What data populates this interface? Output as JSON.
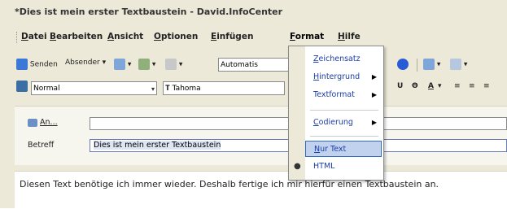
{
  "window": {
    "title": "*Dies ist mein erster Textbaustein - David.InfoCenter"
  },
  "menubar": {
    "items": [
      {
        "label": "Datei"
      },
      {
        "label": "Bearbeiten"
      },
      {
        "label": "Ansicht"
      },
      {
        "label": "Optionen"
      },
      {
        "label": "Einfügen"
      },
      {
        "label": "Format"
      },
      {
        "label": "Hilfe"
      }
    ]
  },
  "toolbar": {
    "send_label": "Senden",
    "sender_label": "Absender",
    "auto_label": "Automatis"
  },
  "format_toolbar": {
    "style_value": "Normal",
    "font_value": "Tahoma"
  },
  "header": {
    "to_label": "An...",
    "to_value": "",
    "subject_label": "Betreff",
    "subject_value": "Dies ist mein erster Textbaustein"
  },
  "body": {
    "text": "Diesen Text benötige ich immer wieder. Deshalb fertige ich mir hierfür einen Textbaustein an."
  },
  "format_menu": {
    "items": [
      {
        "label": "Zeichensatz",
        "submenu": false
      },
      {
        "label": "Hintergrund",
        "submenu": true
      },
      {
        "label": "Textformat",
        "submenu": true
      },
      {
        "label": "Codierung",
        "submenu": true
      },
      {
        "label": "Nur Text",
        "submenu": false,
        "highlighted": true
      },
      {
        "label": "HTML",
        "submenu": false,
        "checked": true
      }
    ]
  },
  "colors": {
    "accent": "#316ac5",
    "menu_text": "#1a3da8",
    "chrome": "#ece9d8"
  }
}
